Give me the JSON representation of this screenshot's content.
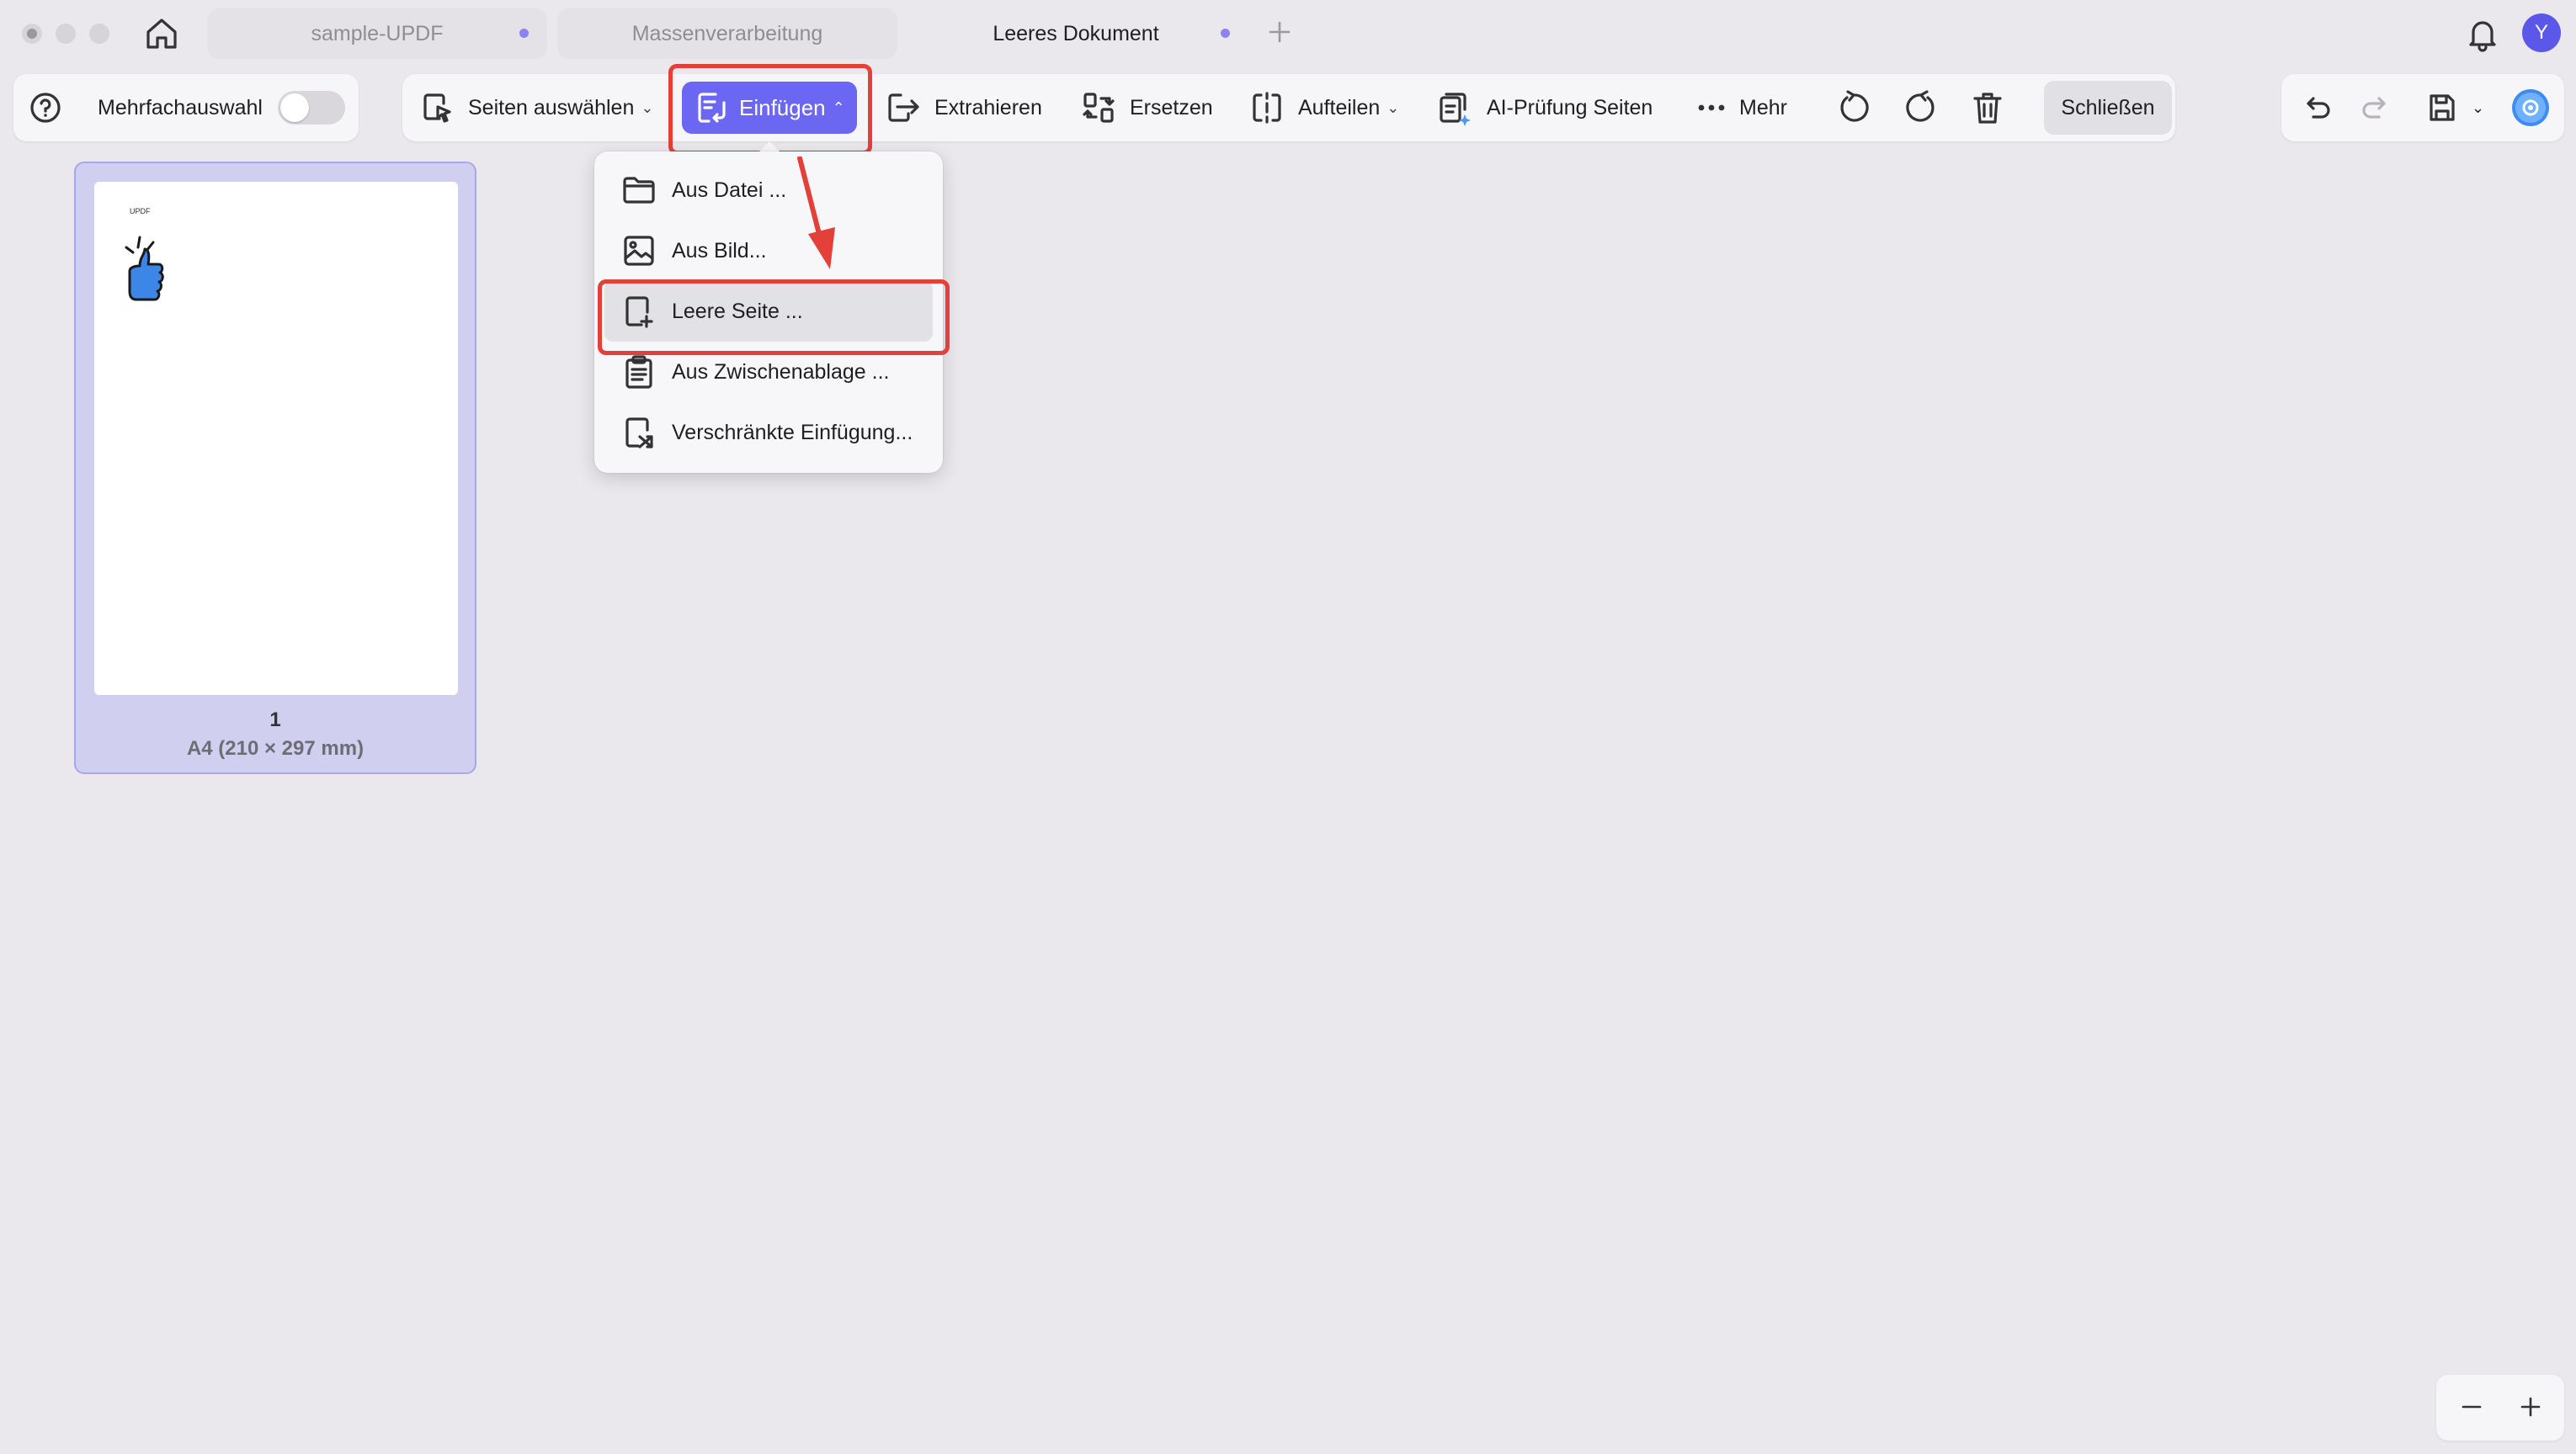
{
  "tabs": [
    {
      "label": "sample-UPDF",
      "unsaved": true
    },
    {
      "label": "Massenverarbeitung",
      "unsaved": false
    },
    {
      "label": "Leeres Dokument",
      "unsaved": true
    }
  ],
  "user": {
    "avatar_initial": "Y"
  },
  "toolbar": {
    "multi_select_label": "Mehrfachauswahl",
    "multi_select_on": false,
    "select_pages": "Seiten auswählen",
    "insert": "Einfügen",
    "extract": "Extrahieren",
    "replace": "Ersetzen",
    "split": "Aufteilen",
    "ai_check": "AI-Prüfung Seiten",
    "more": "Mehr",
    "close": "Schließen"
  },
  "insert_menu": {
    "items": [
      {
        "label": "Aus Datei ...",
        "icon": "folder-icon"
      },
      {
        "label": "Aus Bild...",
        "icon": "image-icon"
      },
      {
        "label": "Leere Seite ...",
        "icon": "blank-page-plus-icon",
        "highlighted": true
      },
      {
        "label": "Aus Zwischenablage ...",
        "icon": "clipboard-icon"
      },
      {
        "label": "Verschränkte Einfügung...",
        "icon": "shuffle-page-icon"
      }
    ]
  },
  "pages": [
    {
      "number": "1",
      "size": "A4 (210 × 297 mm)",
      "thumbnail_text": "UPDF",
      "selected": true
    }
  ],
  "colors": {
    "accent": "#6b67f2",
    "highlight_box": "#e3403a",
    "selected_thumb": "#d1cfef",
    "background": "#eae8ec"
  }
}
